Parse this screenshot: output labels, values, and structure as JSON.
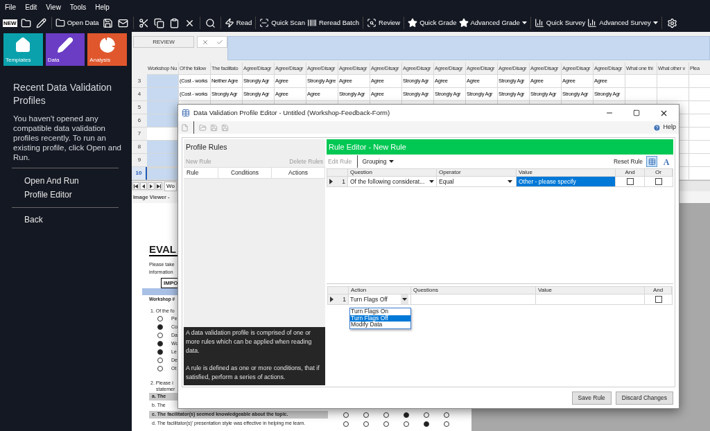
{
  "menu": [
    "File",
    "Edit",
    "View",
    "Tools",
    "Help"
  ],
  "toolbar": {
    "new_badge": "NEW",
    "items": [
      {
        "label": "Open Data",
        "dropdown": false
      },
      {
        "label": "Read",
        "dropdown": false
      },
      {
        "label": "Quick Scan",
        "dropdown": false
      },
      {
        "label": "Reread Batch",
        "dropdown": false
      },
      {
        "label": "Review",
        "dropdown": false
      },
      {
        "label": "Quick Grade",
        "dropdown": false
      },
      {
        "label": "Advanced Grade",
        "dropdown": true
      },
      {
        "label": "Quick Survey",
        "dropdown": false
      },
      {
        "label": "Advanced Survey",
        "dropdown": true
      }
    ]
  },
  "tiles": [
    {
      "label": "Templates",
      "color": "#0aa1ac"
    },
    {
      "label": "Data",
      "color": "#6a3dc4"
    },
    {
      "label": "Analysis",
      "color": "#e0572d"
    }
  ],
  "sidebar": {
    "title": "Recent Data Validation Profiles",
    "message": "You haven't opened any compatible data validation profiles recently. To run an existing profile, click Open and Run.",
    "actions": [
      "Open And Run",
      "Profile Editor"
    ],
    "back": "Back"
  },
  "review_bar": {
    "button": "REVIEW"
  },
  "sheet": {
    "columns": [
      "Workshop Nu",
      "Of the follow",
      "The facilitato",
      "Agree/Disagr",
      "Agree/Disagr",
      "Agree/Disagr",
      "Agree/Disagr",
      "Agree/Disagr",
      "Agree/Disagr",
      "Agree/Disagr",
      "Agree/Disagr",
      "Agree/Disagr",
      "Agree/Disagr",
      "Agree/Disagr",
      "Agree/Disagr",
      "What one thi",
      "What other v",
      "Plea"
    ],
    "rows": [
      {
        "number": "3",
        "selected": false,
        "flagged": true,
        "cells": [
          "(Cost - works",
          "Neither Agre",
          "Strongly Agr",
          "Agree",
          "Strongly Agre",
          "Agree",
          "Agree",
          "Strongly Agr",
          "Agree",
          "Agree",
          "Strongly Agr",
          "Agree",
          "Agree",
          "Agree"
        ]
      },
      {
        "number": "4",
        "selected": false,
        "flagged": true,
        "cells": [
          "(Cost - works",
          "Strongly Agr",
          "Strongly Agr",
          "Agree",
          "Agree",
          "Strongly Agr",
          "Agree",
          "Strongly Agr",
          "Strongly Agr",
          "Strongly Agr",
          "Strongly Agr",
          "Strongly Agr",
          "Strongly Agr",
          "Strongly Agr"
        ]
      },
      {
        "number": "5",
        "selected": false,
        "flagged": true
      },
      {
        "number": "6",
        "selected": false,
        "flagged": true
      },
      {
        "number": "7",
        "selected": false,
        "flagged": false
      },
      {
        "number": "8",
        "selected": false,
        "flagged": true
      },
      {
        "number": "9",
        "selected": false,
        "flagged": true
      },
      {
        "number": "10",
        "selected": true,
        "flagged": true
      }
    ],
    "tab": "Wo"
  },
  "image_viewer": {
    "title": "Image Viewer -",
    "heading": "EVAL",
    "intro": [
      "Please take",
      "information"
    ],
    "notice": "IMPO",
    "workshop": "Workshop #",
    "question_1": "1. Of the fo",
    "options": [
      {
        "text": "Pe",
        "filled": false
      },
      {
        "text": "Co",
        "filled": true
      },
      {
        "text": "Da",
        "filled": false
      },
      {
        "text": "Wo",
        "filled": true
      },
      {
        "text": "Le",
        "filled": true
      },
      {
        "text": "De",
        "filled": false
      },
      {
        "text": "Ot",
        "filled": false
      }
    ],
    "question_2": [
      "2. Please i",
      "statemer"
    ],
    "statements": [
      {
        "letter": "a.",
        "text": "The",
        "shaded": true
      },
      {
        "letter": "b.",
        "text": "The",
        "shaded": false
      },
      {
        "letter": "c.",
        "text": "The facilitator(s) seemed knowledgeable about the topic.",
        "shaded": true,
        "bubbles": [
          false,
          false,
          false,
          true,
          false,
          false
        ]
      },
      {
        "letter": "d.",
        "text": "The facilitator(s)' presentation style was effective in helping me learn.",
        "shaded": false,
        "bubbles": [
          false,
          false,
          false,
          false,
          true,
          false
        ]
      }
    ]
  },
  "dialog": {
    "title": "Data Validation Profile Editor - Untitled (Workshop-Feedback-Form)",
    "help": "Help",
    "profile_rules": {
      "title": "Profile Rules",
      "new_rule": "New Rule",
      "delete_rules": "Delete Rules",
      "columns": [
        "Rule",
        "Conditions",
        "Actions"
      ],
      "info": [
        "A data validation profile is comprised of one or more rules which can be applied when reading  data.",
        "A rule is defined as one or more conditions, that if satisfied, perform a series of actions."
      ]
    },
    "rule_editor": {
      "title": "Rule Editor - New Rule",
      "edit_rule": "Edit Rule",
      "grouping": "Grouping",
      "reset_rule": "Reset Rule",
      "grid_view_selected": true,
      "text_view": "A",
      "condition_columns": [
        "Question",
        "Operator",
        "Value",
        "And",
        "Or"
      ],
      "conditions": [
        {
          "number": "1",
          "question": "Of the following considerat...",
          "operator": "Equal",
          "value": "Other - please specify",
          "value_selected": true,
          "and": false,
          "or": false
        }
      ],
      "action_columns": [
        "Action",
        "Questions",
        "Value",
        "And"
      ],
      "actions": [
        {
          "number": "1",
          "action": "Turn Flags Off",
          "open": true,
          "and": false,
          "options": [
            {
              "label": "Turn Flags On",
              "selected": false
            },
            {
              "label": "Turn Flags Off",
              "selected": true
            },
            {
              "label": "Modify Data",
              "selected": false
            }
          ]
        }
      ]
    },
    "buttons": [
      "Save Rule",
      "Discard Changes"
    ]
  }
}
